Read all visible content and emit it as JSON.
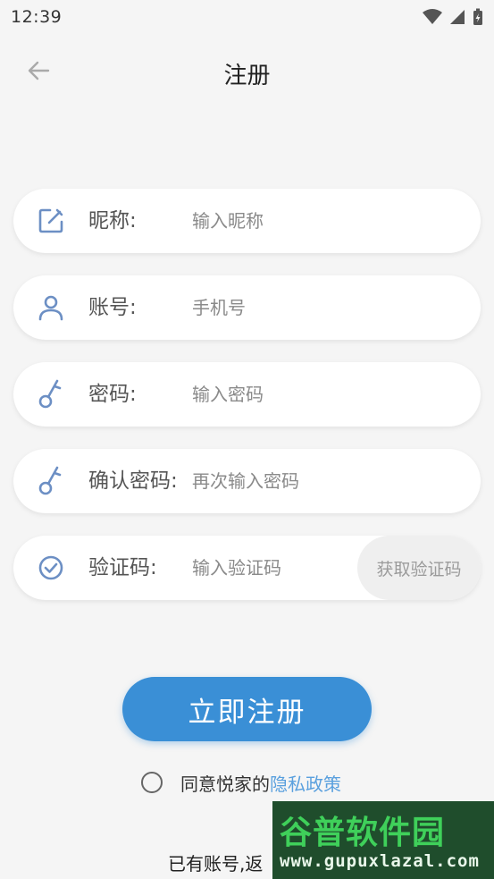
{
  "status_bar": {
    "time": "12:39"
  },
  "header": {
    "title": "注册"
  },
  "form": {
    "nickname": {
      "label": "昵称:",
      "placeholder": "输入昵称",
      "value": ""
    },
    "account": {
      "label": "账号:",
      "placeholder": "手机号",
      "value": ""
    },
    "password": {
      "label": "密码:",
      "placeholder": "输入密码",
      "value": ""
    },
    "confirm_password": {
      "label": "确认密码:",
      "placeholder": "再次输入密码",
      "value": ""
    },
    "code": {
      "label": "验证码:",
      "placeholder": "输入验证码",
      "value": "",
      "button_label": "获取验证码"
    }
  },
  "submit_label": "立即注册",
  "agreement": {
    "checked": false,
    "text": "同意悦家的",
    "link": "隐私政策"
  },
  "login_prompt": "已有账号,返",
  "watermark": {
    "top": "谷普软件园",
    "bottom": "www.gupuxlazal.com"
  },
  "colors": {
    "accent": "#3a8fd6",
    "link": "#5aa0de",
    "icon": "#6c8fc4"
  }
}
